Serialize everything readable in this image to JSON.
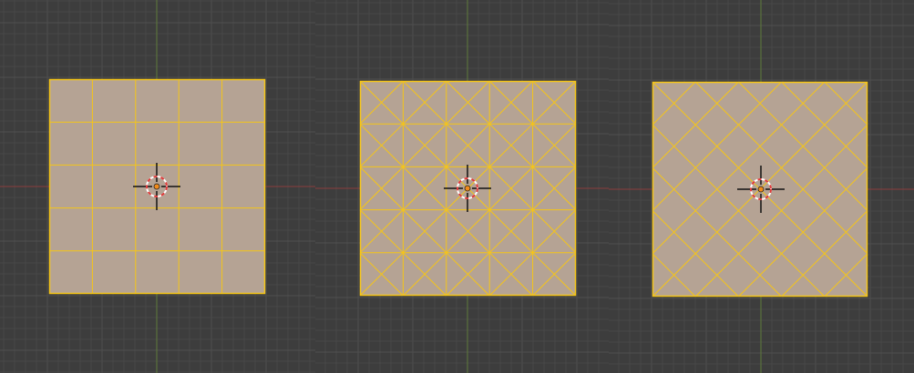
{
  "colors": {
    "background": "#3d3d3d",
    "grid_minor": "#484848",
    "grid_major": "#4f4f4f",
    "axis_x": "#8a3d3d",
    "axis_y": "#5e7a3a",
    "face_fill": "#b5a394",
    "wire_selected": "#f5c518",
    "cursor_ring_red": "#e03a3a",
    "cursor_ring_white": "#ffffff",
    "cursor_crosshair": "#111111",
    "origin_dot": "#f08a1a"
  },
  "viewports": [
    {
      "name": "viewport-left",
      "mesh_pattern": "quad-grid",
      "subdivisions": 5
    },
    {
      "name": "viewport-center",
      "mesh_pattern": "quad-grid-x",
      "subdivisions": 5
    },
    {
      "name": "viewport-right",
      "mesh_pattern": "diagonal-grid",
      "subdivisions": 5
    }
  ],
  "icons": {
    "cursor": "3d-cursor-icon",
    "origin": "object-origin-icon"
  }
}
